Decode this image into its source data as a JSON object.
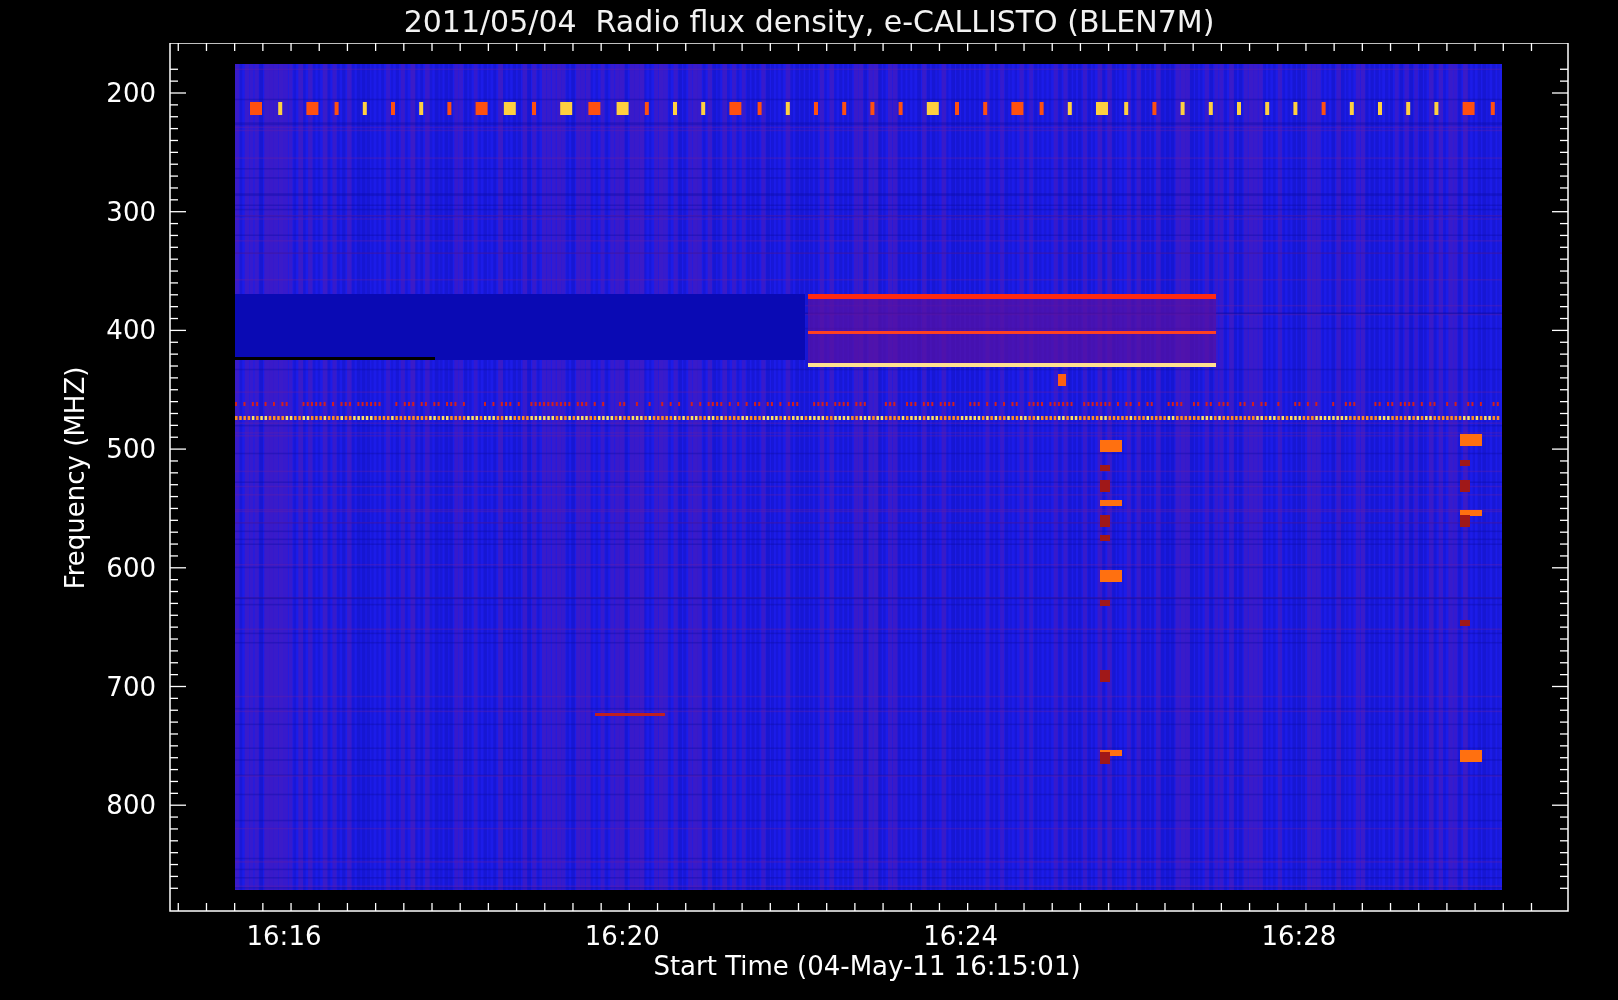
{
  "plot": {
    "title": "2011/05/04  Radio flux density, e-CALLISTO (BLEN7M)",
    "ylabel": "Frequency (MHZ)",
    "xlabel": "Start Time (04-May-11 16:15:01)",
    "yticks": [
      "200",
      "300",
      "400",
      "500",
      "600",
      "700",
      "800"
    ],
    "xticks": [
      "16:16",
      "16:20",
      "16:24",
      "16:28"
    ]
  }
}
